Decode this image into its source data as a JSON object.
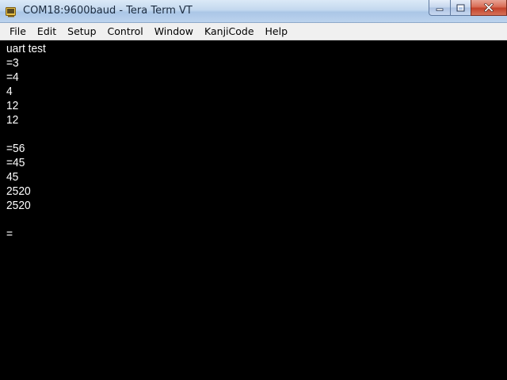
{
  "window": {
    "title": "COM18:9600baud - Tera Term VT",
    "app_icon": "tera-term-icon",
    "controls": {
      "minimize": "minimize-icon",
      "maximize": "maximize-icon",
      "close": "close-icon"
    }
  },
  "menu": {
    "items": [
      "File",
      "Edit",
      "Setup",
      "Control",
      "Window",
      "KanjiCode",
      "Help"
    ]
  },
  "terminal": {
    "lines": [
      "uart test",
      "=3",
      "=4",
      "4",
      "12",
      "12",
      "",
      "=56",
      "=45",
      "45",
      "2520",
      "2520",
      "",
      "="
    ]
  },
  "colors": {
    "terminal_bg": "#000000",
    "terminal_fg": "#ffffff",
    "menubar_bg": "#f0f0f0",
    "close_button": "#c3412a"
  }
}
